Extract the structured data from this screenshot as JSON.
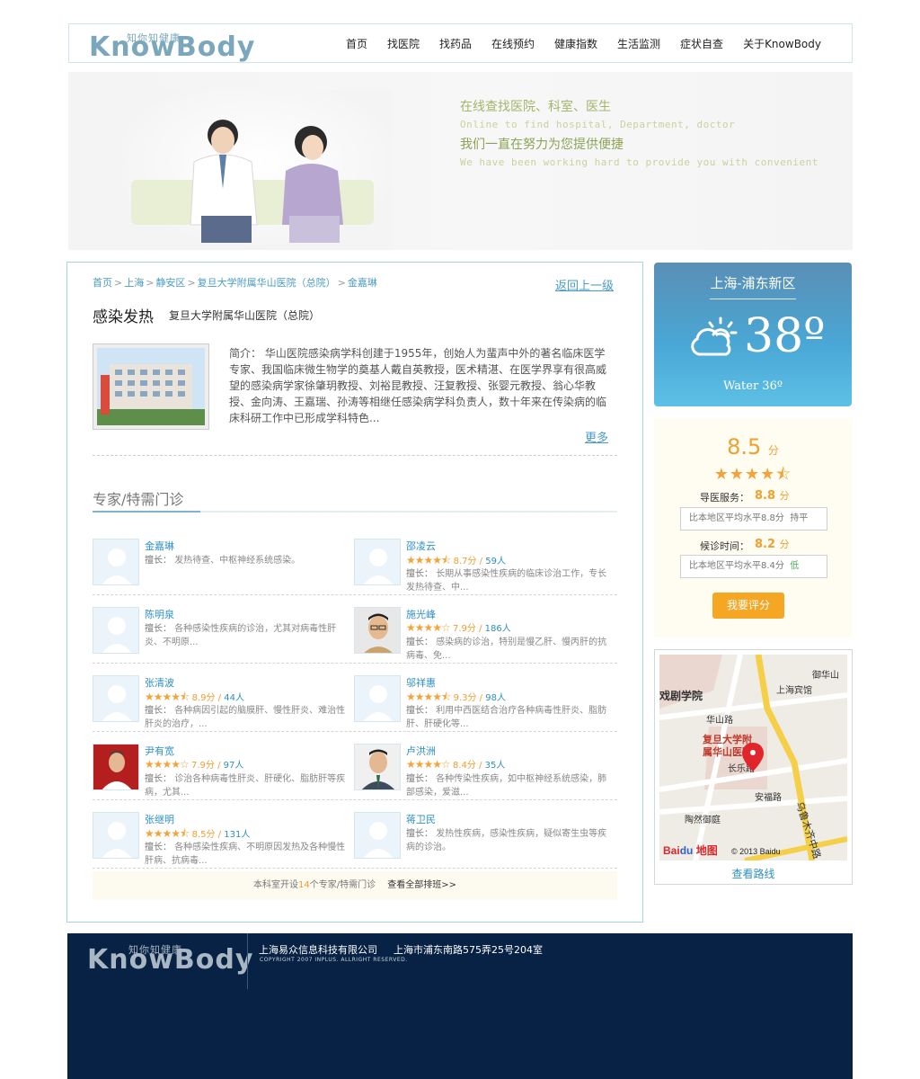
{
  "header": {
    "logo_cn": "知你知健康",
    "logo_en": "KnowBody",
    "nav": [
      "首页",
      "找医院",
      "找药品",
      "在线预约",
      "健康指数",
      "生活监测",
      "症状自查",
      "关于KnowBody"
    ]
  },
  "banner": {
    "line1": "在线查找医院、科室、医生",
    "line2": "Online to find hospital, Department, doctor",
    "line3": "我们一直在努力为您提供便捷",
    "line4": "We have been working hard to provide you with convenient"
  },
  "breadcrumb": [
    "首页",
    "上海",
    "静安区",
    "复旦大学附属华山医院（总院）",
    "金嘉琳"
  ],
  "back_link": "返回上一级",
  "department": {
    "title": "感染发热",
    "hospital": "复旦大学附属华山医院（总院）",
    "description": "简介：  华山医院感染病学科创建于1955年，创始人为蜚声中外的著名临床医学专家、我国临床微生物学的奠基人戴自英教授，医术精湛、在医学界享有很高威望的感染病学家徐肇玥教授、刘裕昆教授、汪复教授、张婴元教授、翁心华教授、金向涛、王嘉瑞、孙涛等相继任感染病学科负责人，数十年来在传染病的临床科研工作中已形成学科特色...",
    "more": "更多"
  },
  "section_title": "专家/特需门诊",
  "doctors": [
    {
      "name": "金嘉琳",
      "has_rating": false,
      "score": "",
      "count": "",
      "spec_label": "擅长：",
      "spec": "发热待查、中枢神经系统感染。",
      "photo": "placeholder"
    },
    {
      "name": "邵凌云",
      "has_rating": true,
      "stars": 4.5,
      "score": "8.7分",
      "count": "59人",
      "spec_label": "擅长：",
      "spec": "长期从事感染性疾病的临床诊治工作，专长发热待查、中...",
      "photo": "placeholder"
    },
    {
      "name": "陈明泉",
      "has_rating": false,
      "score": "",
      "count": "",
      "spec_label": "擅长：",
      "spec": "各种感染性疾病的诊治，尤其对病毒性肝炎、不明原...",
      "photo": "placeholder"
    },
    {
      "name": "施光峰",
      "has_rating": true,
      "stars": 4,
      "score": "7.9分",
      "count": "186人",
      "spec_label": "擅长：",
      "spec": "感染病的诊治，特别是慢乙肝、慢丙肝的抗病毒、免...",
      "photo": "man-glasses"
    },
    {
      "name": "张清波",
      "has_rating": true,
      "stars": 4.5,
      "score": "8.9分",
      "count": "44人",
      "spec_label": "擅长：",
      "spec": "各种病因引起的脑膜肝、慢性肝炎、难治性肝炎的治疗，...",
      "photo": "placeholder"
    },
    {
      "name": "邬祥惠",
      "has_rating": true,
      "stars": 4.5,
      "score": "9.3分",
      "count": "98人",
      "spec_label": "擅长：",
      "spec": "利用中西医结合治疗各种病毒性肝炎、脂肪肝、肝硬化等...",
      "photo": "placeholder"
    },
    {
      "name": "尹有宽",
      "has_rating": true,
      "stars": 4,
      "score": "7.9分",
      "count": "97人",
      "spec_label": "擅长：",
      "spec": "诊治各种病毒性肝炎、肝硬化、脂肪肝等疾病，尤其...",
      "photo": "man-red"
    },
    {
      "name": "卢洪洲",
      "has_rating": true,
      "stars": 4,
      "score": "8.4分",
      "count": "35人",
      "spec_label": "擅长：",
      "spec": "各种传染性疾病，如中枢神经系统感染，肺部感染，爱滋...",
      "photo": "man-tie"
    },
    {
      "name": "张继明",
      "has_rating": true,
      "stars": 4.5,
      "score": "8.5分",
      "count": "131人",
      "spec_label": "擅长：",
      "spec": "各种感染性疾病、不明原因发热及各种慢性肝病、抗病毒...",
      "photo": "placeholder"
    },
    {
      "name": "蒋卫民",
      "has_rating": false,
      "score": "",
      "count": "",
      "spec_label": "擅长：",
      "spec": "发热性疾病，感染性疾病，疑似寄生虫等疾病的诊治。",
      "photo": "placeholder"
    }
  ],
  "docs_footer": {
    "prefix": "本科室开设",
    "num": "14",
    "suffix": "个专家/特需门诊",
    "all": "查看全部排班>>"
  },
  "weather": {
    "city": "上海-浦东新区",
    "temp": "38º",
    "water": "Water 36º",
    "icon": "partly-cloudy-icon"
  },
  "rating": {
    "overall": "8.5",
    "unit": "分",
    "stars": 4.5,
    "service_label": "导医服务：",
    "service_value": "8.8",
    "service_compare": "比本地区平均水平8.8分",
    "service_tag": "持平",
    "wait_label": "候诊时间：",
    "wait_value": "8.2",
    "wait_compare": "比本地区平均水平8.4分",
    "wait_tag": "低",
    "button": "我要评分"
  },
  "map": {
    "labels": [
      "御华山",
      "上海宾馆",
      "戏剧学院",
      "华山路",
      "复旦大学附属华山医院",
      "长乐路",
      "乌鲁木齐中路",
      "安福路",
      "陶然御庭",
      "© 2013 Baidu",
      "Baidu地图"
    ],
    "route": "查看路线"
  },
  "footer": {
    "logo_cn": "知你知健康",
    "logo_en": "KnowBody",
    "company": "上海易众信息科技有限公司",
    "address": "上海市浦东南路575弄25号204室",
    "copyright": "COPYRIGHT 2007 INPLUS. ALLRIGHT RESERVED."
  },
  "colors": {
    "link": "#2f8fc4",
    "accent": "#f5a623",
    "footer_bg": "#072244",
    "border": "#a9d3e2"
  }
}
